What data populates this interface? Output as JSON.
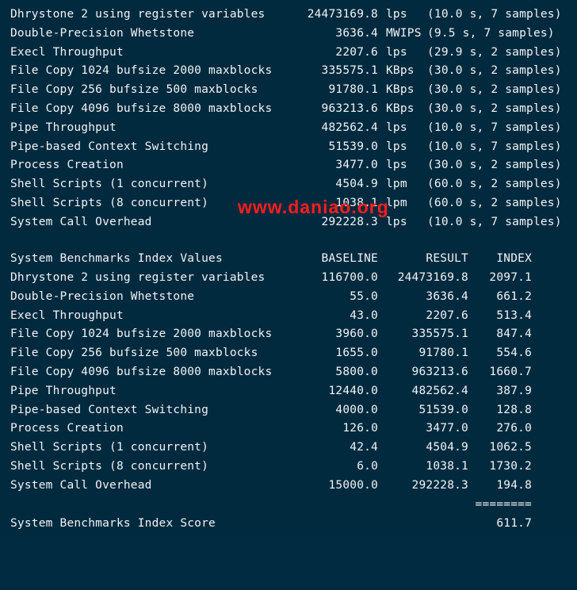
{
  "watermark": "www.daniao.org",
  "results": [
    {
      "name": "Dhrystone 2 using register variables",
      "value": "24473169.8",
      "unit": "lps",
      "note": "(10.0 s, 7 samples)"
    },
    {
      "name": "Double-Precision Whetstone",
      "value": "3636.4",
      "unit": "MWIPS",
      "note": "(9.5 s, 7 samples)"
    },
    {
      "name": "Execl Throughput",
      "value": "2207.6",
      "unit": "lps",
      "note": "(29.9 s, 2 samples)"
    },
    {
      "name": "File Copy 1024 bufsize 2000 maxblocks",
      "value": "335575.1",
      "unit": "KBps",
      "note": "(30.0 s, 2 samples)"
    },
    {
      "name": "File Copy 256 bufsize 500 maxblocks",
      "value": "91780.1",
      "unit": "KBps",
      "note": "(30.0 s, 2 samples)"
    },
    {
      "name": "File Copy 4096 bufsize 8000 maxblocks",
      "value": "963213.6",
      "unit": "KBps",
      "note": "(30.0 s, 2 samples)"
    },
    {
      "name": "Pipe Throughput",
      "value": "482562.4",
      "unit": "lps",
      "note": "(10.0 s, 7 samples)"
    },
    {
      "name": "Pipe-based Context Switching",
      "value": "51539.0",
      "unit": "lps",
      "note": "(10.0 s, 7 samples)"
    },
    {
      "name": "Process Creation",
      "value": "3477.0",
      "unit": "lps",
      "note": "(30.0 s, 2 samples)"
    },
    {
      "name": "Shell Scripts (1 concurrent)",
      "value": "4504.9",
      "unit": "lpm",
      "note": "(60.0 s, 2 samples)"
    },
    {
      "name": "Shell Scripts (8 concurrent)",
      "value": "1038.1",
      "unit": "lpm",
      "note": "(60.0 s, 2 samples)"
    },
    {
      "name": "System Call Overhead",
      "value": "292228.3",
      "unit": "lps",
      "note": "(10.0 s, 7 samples)"
    }
  ],
  "index_header": {
    "title": "System Benchmarks Index Values",
    "baseline": "BASELINE",
    "result": "RESULT",
    "index": "INDEX"
  },
  "index_rows": [
    {
      "name": "Dhrystone 2 using register variables",
      "baseline": "116700.0",
      "result": "24473169.8",
      "index": "2097.1"
    },
    {
      "name": "Double-Precision Whetstone",
      "baseline": "55.0",
      "result": "3636.4",
      "index": "661.2"
    },
    {
      "name": "Execl Throughput",
      "baseline": "43.0",
      "result": "2207.6",
      "index": "513.4"
    },
    {
      "name": "File Copy 1024 bufsize 2000 maxblocks",
      "baseline": "3960.0",
      "result": "335575.1",
      "index": "847.4"
    },
    {
      "name": "File Copy 256 bufsize 500 maxblocks",
      "baseline": "1655.0",
      "result": "91780.1",
      "index": "554.6"
    },
    {
      "name": "File Copy 4096 bufsize 8000 maxblocks",
      "baseline": "5800.0",
      "result": "963213.6",
      "index": "1660.7"
    },
    {
      "name": "Pipe Throughput",
      "baseline": "12440.0",
      "result": "482562.4",
      "index": "387.9"
    },
    {
      "name": "Pipe-based Context Switching",
      "baseline": "4000.0",
      "result": "51539.0",
      "index": "128.8"
    },
    {
      "name": "Process Creation",
      "baseline": "126.0",
      "result": "3477.0",
      "index": "276.0"
    },
    {
      "name": "Shell Scripts (1 concurrent)",
      "baseline": "42.4",
      "result": "4504.9",
      "index": "1062.5"
    },
    {
      "name": "Shell Scripts (8 concurrent)",
      "baseline": "6.0",
      "result": "1038.1",
      "index": "1730.2"
    },
    {
      "name": "System Call Overhead",
      "baseline": "15000.0",
      "result": "292228.3",
      "index": "194.8"
    }
  ],
  "separator": "========",
  "score": {
    "label": "System Benchmarks Index Score",
    "value": "611.7"
  }
}
